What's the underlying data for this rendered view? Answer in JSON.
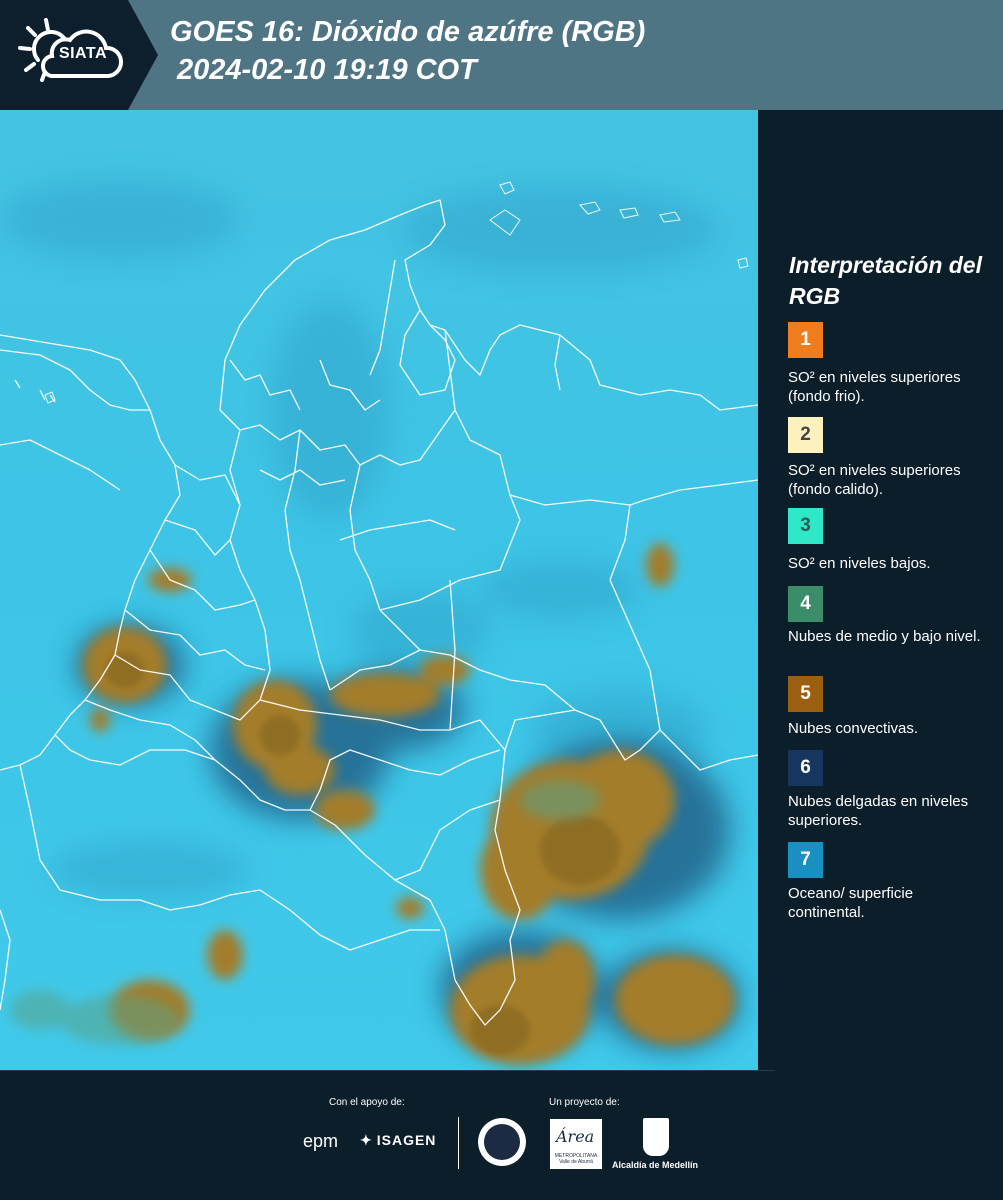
{
  "header": {
    "logo_text": "SIATA",
    "title_line1": "GOES 16: Dióxido de azúfre (RGB)",
    "title_line2": "2024-02-10 19:19 COT"
  },
  "legend": {
    "title": "Interpretación del RGB",
    "items": [
      {
        "number": "1",
        "label": "SO² en niveles superiores (fondo frio).",
        "color": "#f07d1b",
        "text_color": "#ffffff"
      },
      {
        "number": "2",
        "label": "SO² en niveles superiores (fondo calido).",
        "color": "#fdf2be",
        "text_color": "#444444"
      },
      {
        "number": "3",
        "label": "SO² en niveles bajos.",
        "color": "#2ee8c8",
        "text_color": "#2c5a54"
      },
      {
        "number": "4",
        "label": "Nubes de medio y bajo nivel.",
        "color": "#3b8c68",
        "text_color": "#ffffff"
      },
      {
        "number": "5",
        "label": "Nubes convectivas.",
        "color": "#9b5f12",
        "text_color": "#ffffff"
      },
      {
        "number": "6",
        "label": "Nubes delgadas en niveles superiores.",
        "color": "#163660",
        "text_color": "#ffffff"
      },
      {
        "number": "7",
        "label": "Oceano/ superficie continental.",
        "color": "#1a8fc2",
        "text_color": "#ffffff"
      }
    ]
  },
  "footer": {
    "support_label": "Con el apoyo de:",
    "project_label": "Un proyecto de:",
    "sponsor_1": "epm",
    "sponsor_2": "ISAGEN",
    "partner_area": "Área",
    "partner_area_sub": "METROPOLITANA Valle de Aburrá",
    "partner_alcaldia": "Alcaldía de Medellín"
  },
  "colors": {
    "header_bg": "#4f7483",
    "panel_bg": "#0c1e2a",
    "map_base": "#3ec6e6",
    "convective": "#9a7a2a",
    "borders": "#ffffff"
  }
}
